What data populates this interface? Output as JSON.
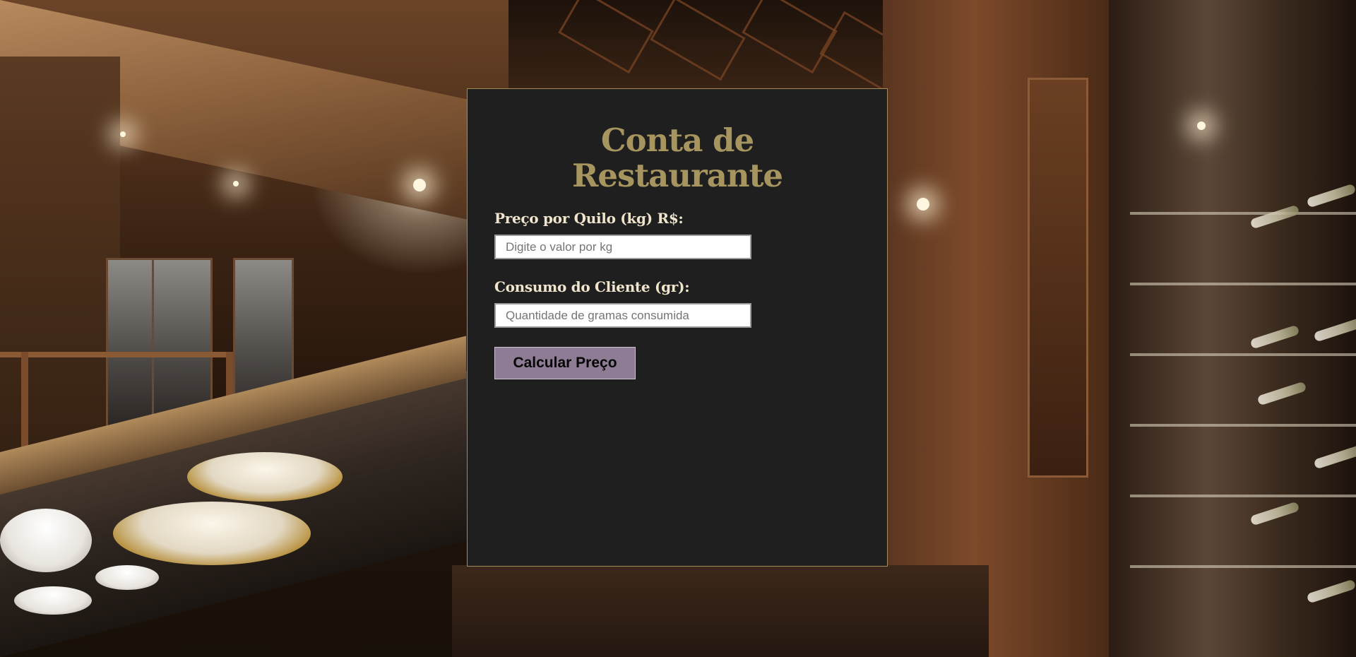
{
  "page": {
    "title": "Conta de Restaurante"
  },
  "form": {
    "price_label": "Preço por Quilo (kg) R$:",
    "price_placeholder": "Digite o valor por kg",
    "price_value": "",
    "consumption_label": "Consumo do Cliente (gr):",
    "consumption_placeholder": "Quantidade de gramas consumida",
    "consumption_value": "",
    "calculate_label": "Calcular Preço"
  },
  "colors": {
    "panel_background": "#1f1f1f",
    "panel_border": "#a58a5c",
    "title": "#a79560",
    "label": "#efe4cc",
    "button_background": "#8e7b94"
  },
  "background": {
    "description_icon": "restaurant-interior-photo"
  }
}
